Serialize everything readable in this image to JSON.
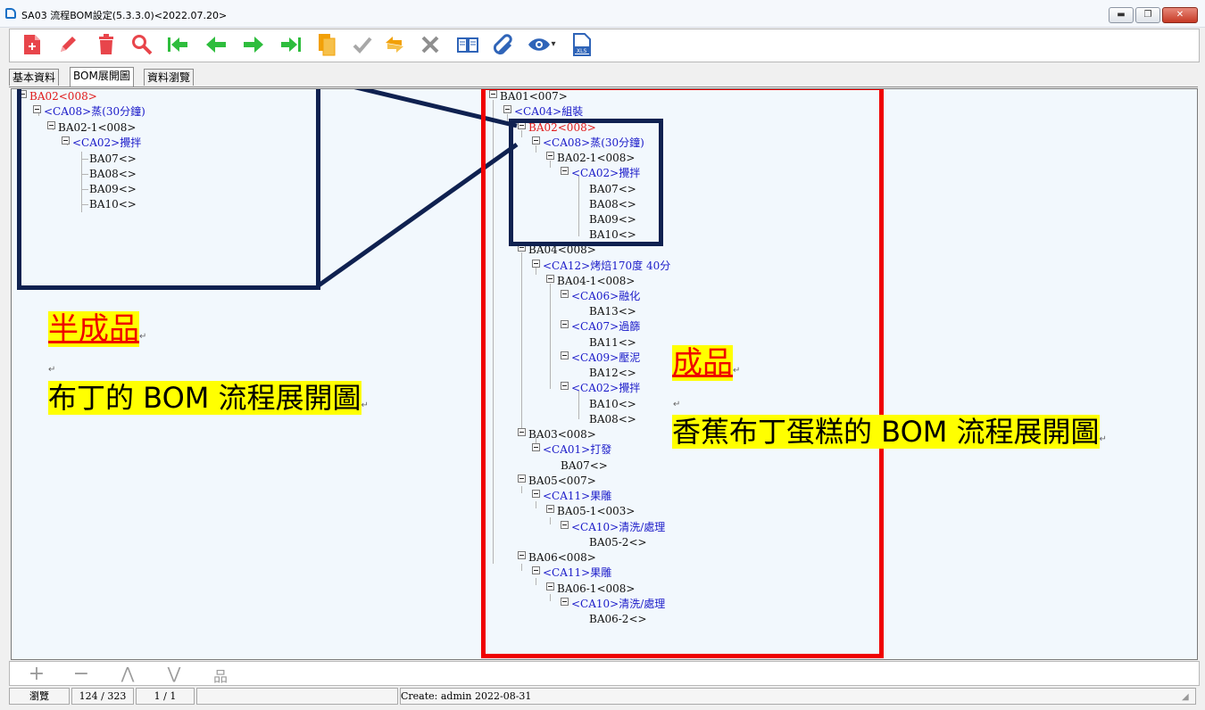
{
  "window": {
    "title": "SA03 流程BOM設定(5.3.3.0)<2022.07.20>",
    "min": "▬",
    "max": "❐",
    "close": "✕"
  },
  "toolbar": {
    "icons": [
      "new-icon",
      "edit-icon",
      "delete-icon",
      "search-icon",
      "first-icon",
      "prev-icon",
      "next-icon",
      "last-icon",
      "copy-icon",
      "confirm-icon",
      "refresh-icon",
      "cancel-icon",
      "book-icon",
      "attach-icon",
      "view-icon",
      "excel-icon"
    ],
    "colors": {
      "red": "#e8454b",
      "green": "#2ebd3d",
      "gray": "#8f8f8f",
      "blue": "#2f64b8"
    }
  },
  "tabs": [
    {
      "label": "基本資料"
    },
    {
      "label": "BOM展開圖"
    },
    {
      "label": "資料瀏覽"
    }
  ],
  "left_tree": [
    {
      "text": "BA02<008>"
    },
    {
      "text": "<CA08>蒸(30分鐘)"
    },
    {
      "text": "BA02-1<008>"
    },
    {
      "text": "<CA02>攪拌"
    },
    {
      "text": "BA07<>"
    },
    {
      "text": "BA08<>"
    },
    {
      "text": "BA09<>"
    },
    {
      "text": "BA10<>"
    }
  ],
  "right_tree": [
    {
      "text": "BA01<007>"
    },
    {
      "text": "<CA04>組裝"
    },
    {
      "text": "BA02<008>"
    },
    {
      "text": "<CA08>蒸(30分鐘)"
    },
    {
      "text": "BA02-1<008>"
    },
    {
      "text": "<CA02>攪拌"
    },
    {
      "text": "BA07<>"
    },
    {
      "text": "BA08<>"
    },
    {
      "text": "BA09<>"
    },
    {
      "text": "BA10<>"
    },
    {
      "text": "BA04<008>"
    },
    {
      "text": "<CA12>烤焙170度 40分"
    },
    {
      "text": "BA04-1<008>"
    },
    {
      "text": "<CA06>融化"
    },
    {
      "text": "BA13<>"
    },
    {
      "text": "<CA07>過篩"
    },
    {
      "text": "BA11<>"
    },
    {
      "text": "<CA09>壓泥"
    },
    {
      "text": "BA12<>"
    },
    {
      "text": "<CA02>攪拌"
    },
    {
      "text": "BA10<>"
    },
    {
      "text": "BA08<>"
    },
    {
      "text": "BA03<008>"
    },
    {
      "text": "<CA01>打發"
    },
    {
      "text": "BA07<>"
    },
    {
      "text": "BA05<007>"
    },
    {
      "text": "<CA11>果雕"
    },
    {
      "text": "BA05-1<003>"
    },
    {
      "text": "<CA10>清洗/處理"
    },
    {
      "text": "BA05-2<>"
    },
    {
      "text": "BA06<008>"
    },
    {
      "text": "<CA11>果雕"
    },
    {
      "text": "BA06-1<008>"
    },
    {
      "text": "<CA10>清洗/處理"
    },
    {
      "text": "BA06-2<>"
    }
  ],
  "annotations": {
    "semi_product": "半成品",
    "semi_desc": "布丁的 BOM 流程展開圖",
    "product": "成品",
    "product_desc": "香蕉布丁蛋糕的 BOM 流程展開圖",
    "para_mark": "↵"
  },
  "bottom_tools": {
    "add": "+",
    "remove": "−",
    "up": "⋀",
    "down": "⋁",
    "tree": "品"
  },
  "status": {
    "mode": "瀏覽",
    "record": "124 / 323",
    "page": "1 / 1",
    "create": "Create: admin 2022-08-31"
  }
}
